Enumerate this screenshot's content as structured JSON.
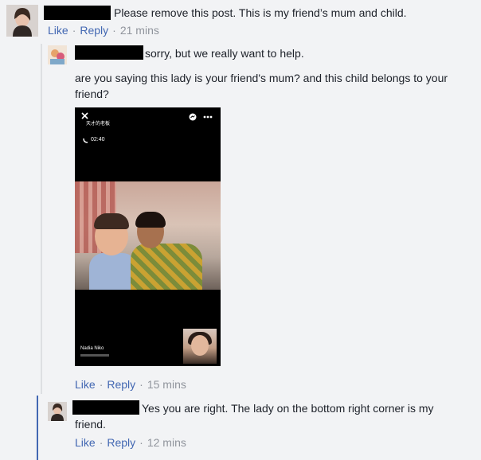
{
  "comments": [
    {
      "text": "Please remove this post. This is my friend’s mum and child.",
      "actions": {
        "like": "Like",
        "reply": "Reply",
        "time": "21 mins"
      }
    },
    {
      "text": "sorry, but we really want to help.",
      "text2": "are you saying this lady is your friend's mum? and this child belongs to your friend?",
      "video": {
        "time": "02:40",
        "caller": "Nadia Niko"
      },
      "actions": {
        "like": "Like",
        "reply": "Reply",
        "time": "15 mins"
      }
    },
    {
      "text": "Yes you are right. The lady on the bottom right corner is my friend.",
      "actions": {
        "like": "Like",
        "reply": "Reply",
        "time": "12 mins"
      }
    }
  ],
  "separator": "·",
  "colors": {
    "link": "#4267b2",
    "meta": "#90949c",
    "text": "#1d2129",
    "background": "#f2f3f5"
  },
  "icons": [
    "close-icon",
    "messenger-icon",
    "more-icon",
    "phone-icon"
  ]
}
